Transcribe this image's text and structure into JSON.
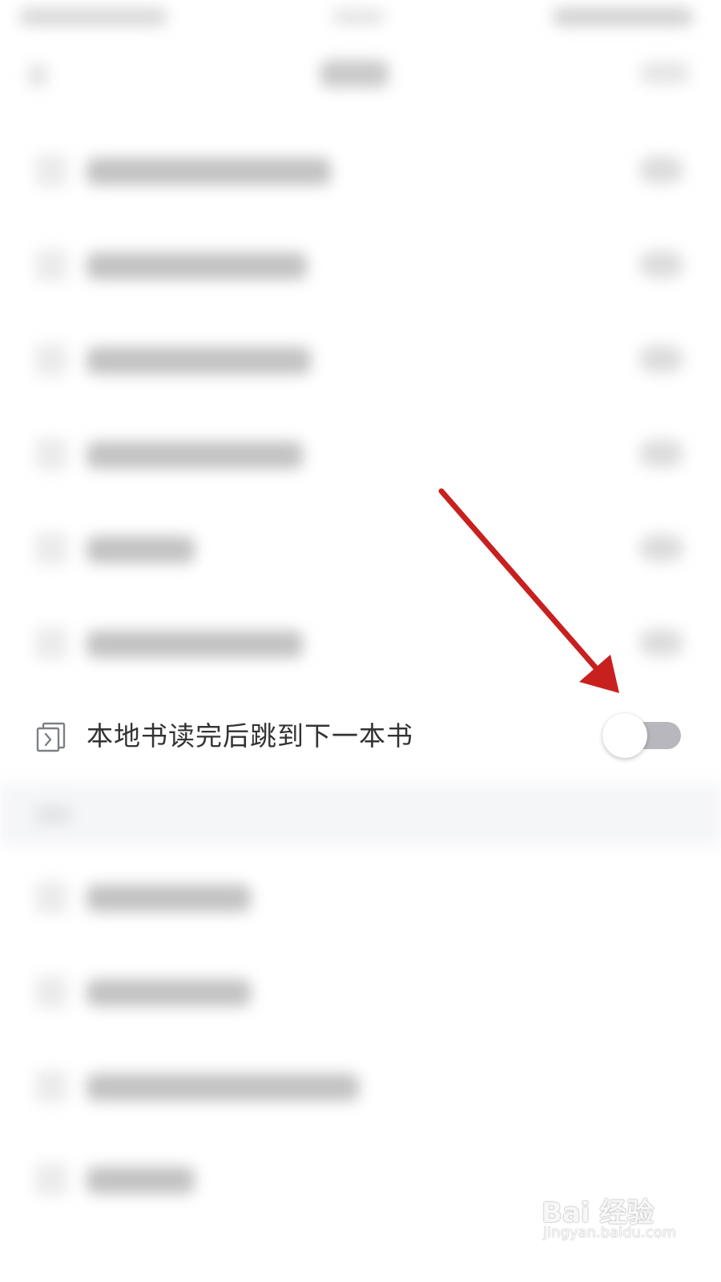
{
  "setting": {
    "label": "本地书读完后跳到下一本书",
    "toggle_state": "off",
    "toggle_track_color": "#b7b7bd",
    "label_color": "#333333",
    "icon": "next-book-icon"
  },
  "annotation": {
    "arrow_color": "#c8201f",
    "points_to": "toggle-switch"
  },
  "watermark": {
    "brand": "Bai 经验",
    "url": "jingyan.baidu.com"
  },
  "colors": {
    "section_background": "#f5f6f8",
    "page_background": "#ffffff"
  }
}
